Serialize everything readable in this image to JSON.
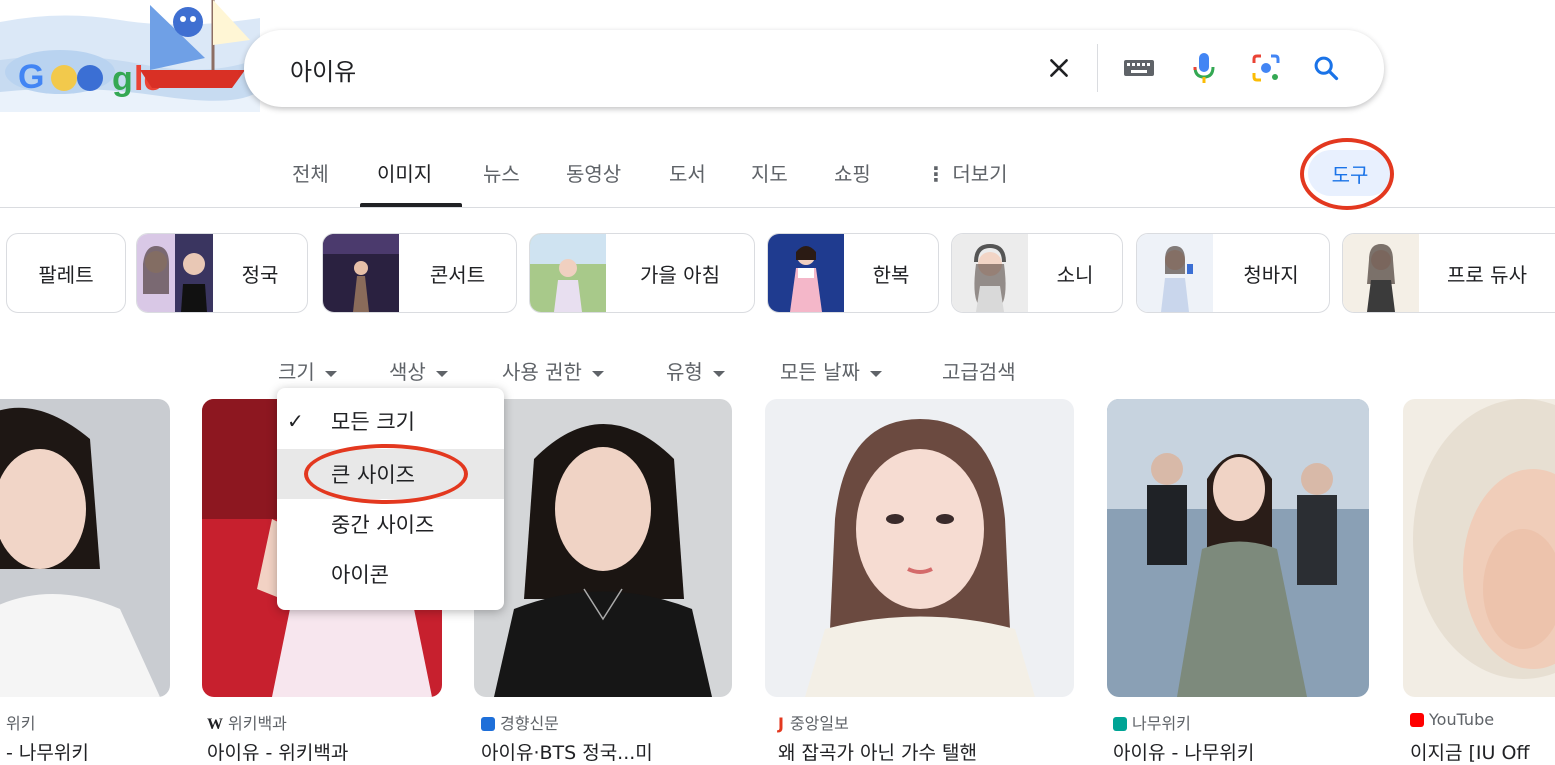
{
  "search": {
    "query": "아이유",
    "icons": [
      "clear-icon",
      "keyboard-icon",
      "microphone-icon",
      "lens-icon",
      "search-icon"
    ]
  },
  "tabs": [
    {
      "label": "전체"
    },
    {
      "label": "이미지"
    },
    {
      "label": "뉴스"
    },
    {
      "label": "동영상"
    },
    {
      "label": "도서"
    },
    {
      "label": "지도"
    },
    {
      "label": "쇼핑"
    },
    {
      "label": "더보기"
    }
  ],
  "tools_label": "도구",
  "chips": [
    {
      "label": "팔레트"
    },
    {
      "label": "정국"
    },
    {
      "label": "콘서트"
    },
    {
      "label": "가을 아침"
    },
    {
      "label": "한복"
    },
    {
      "label": "소니"
    },
    {
      "label": "청바지"
    },
    {
      "label": "프로 듀사"
    }
  ],
  "filters": [
    {
      "label": "크기"
    },
    {
      "label": "색상"
    },
    {
      "label": "사용 권한"
    },
    {
      "label": "유형"
    },
    {
      "label": "모든 날짜"
    },
    {
      "label": "고급검색"
    }
  ],
  "size_menu": {
    "items": [
      {
        "label": "모든 크기",
        "checked": true
      },
      {
        "label": "큰 사이즈"
      },
      {
        "label": "중간 사이즈"
      },
      {
        "label": "아이콘"
      }
    ]
  },
  "results": [
    {
      "source": "위키",
      "title": "- 나무위키"
    },
    {
      "source": "위키백과",
      "title": "아이유 - 위키백과"
    },
    {
      "source": "경향신문",
      "title": "아이유·BTS 정국...미"
    },
    {
      "source": "중앙일보",
      "title": "왜 잡곡가 아닌 가수 탤핸"
    },
    {
      "source": "나무위키",
      "title": "아이유 - 나무위키"
    },
    {
      "source": "YouTube",
      "title": "이지금 [IU Off"
    }
  ],
  "colors": {
    "accent": "#1a73e8",
    "annotation": "#e3381f",
    "tools_bg": "#e8f0fe"
  }
}
